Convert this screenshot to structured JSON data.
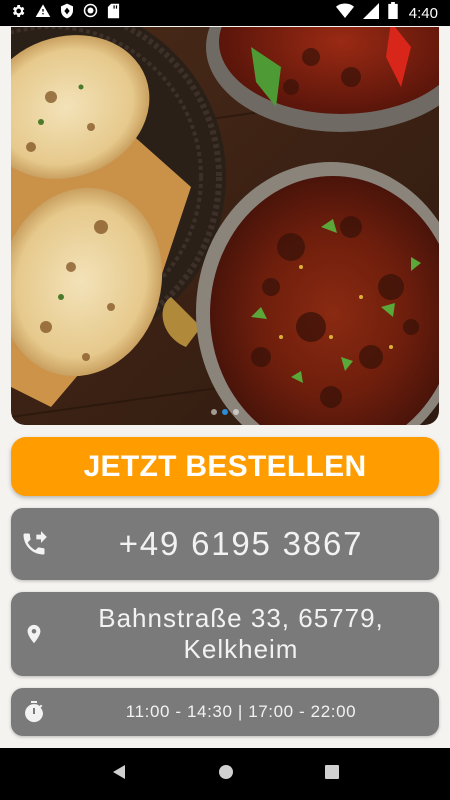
{
  "status_bar": {
    "time": "4:40",
    "left_icons": [
      "gear-icon",
      "warning-icon",
      "shield-icon",
      "circle-icon",
      "sd-card-icon"
    ],
    "right_icons": [
      "wifi-icon",
      "signal-icon",
      "battery-icon"
    ]
  },
  "hero": {
    "image": "indian-food-naan-curry-photo",
    "carousel_dots": 3,
    "active_dot": 1
  },
  "order_button": {
    "label": "JETZT BESTELLEN",
    "color": "#ff9d00"
  },
  "phone": {
    "number": "+49 6195 3867",
    "icon": "phone-forward-icon"
  },
  "address": {
    "line1": "Bahnstraße 33, 65779,",
    "line2": "Kelkheim",
    "icon": "location-pin-icon"
  },
  "hours": {
    "text": "11:00 - 14:30 | 17:00 - 22:00",
    "icon": "stopwatch-icon"
  },
  "nav_bar": {
    "buttons": [
      "back-button",
      "home-button",
      "recents-button"
    ]
  },
  "colors": {
    "card": "#7a7a7a",
    "background": "#f5f3f0",
    "accent_dot": "#2e8bd6"
  }
}
